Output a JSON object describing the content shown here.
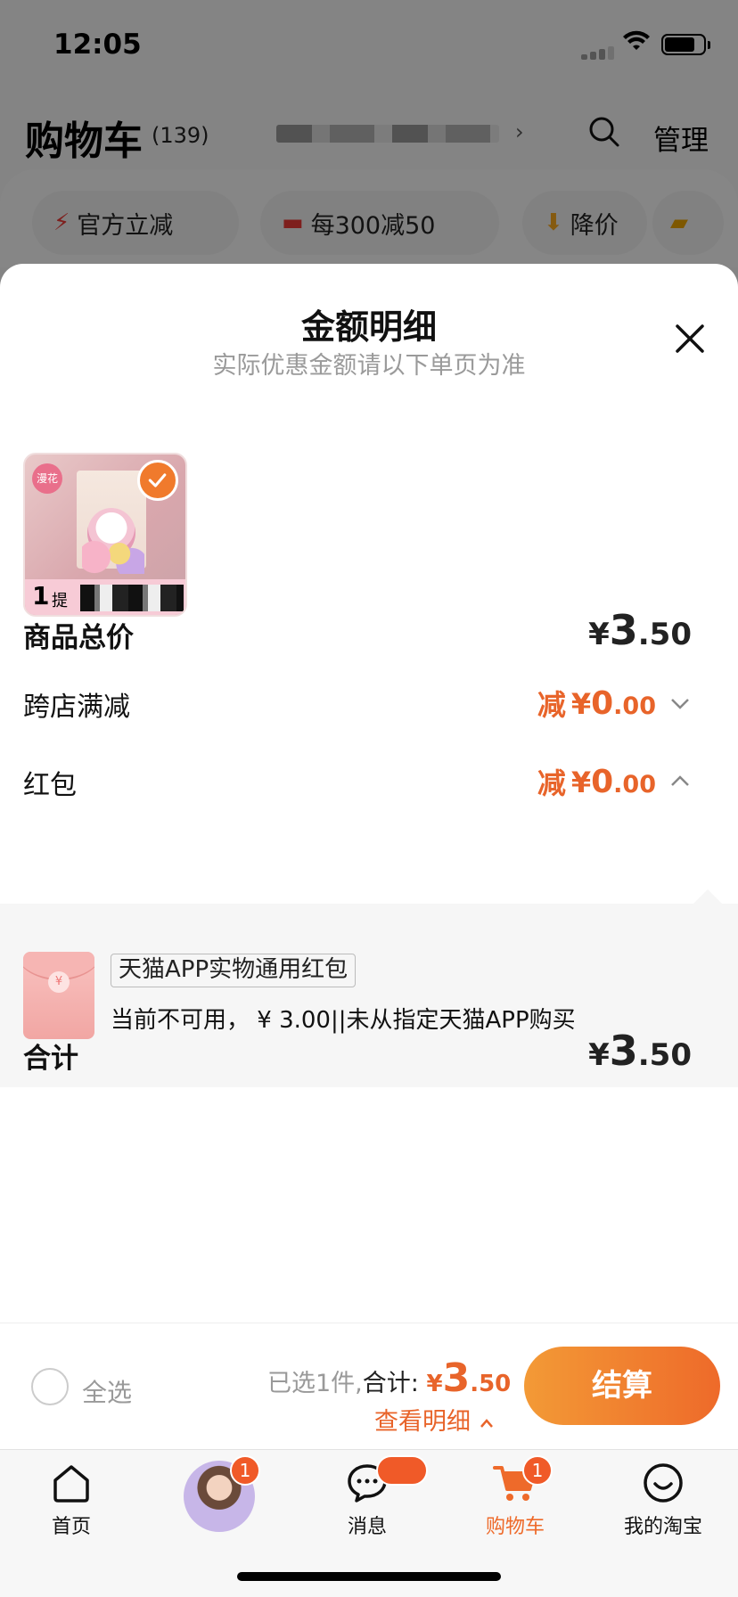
{
  "status_bar": {
    "time": "12:05"
  },
  "cart_header": {
    "title": "购物车",
    "count": "(139)",
    "manage_label": "管理",
    "address_chevron": "›"
  },
  "promo_chips": [
    {
      "icon": "lightning-icon",
      "label": "官方立减"
    },
    {
      "icon": "store-icon",
      "label": "每300减50"
    },
    {
      "icon": "price-drop-icon",
      "label": "降价"
    },
    {
      "icon": "folder-icon",
      "label": ""
    }
  ],
  "sheet": {
    "title": "金额明细",
    "subtitle": "实际优惠金额请以下单页为准",
    "product": {
      "tag": "漫花",
      "count_number": "1",
      "count_unit": "提"
    },
    "rows": {
      "goods_total": {
        "label": "商品总价",
        "currency": "¥",
        "integer": "3",
        "decimal": ".50"
      },
      "cross_store": {
        "label": "跨店满减",
        "prefix": "减",
        "currency": "¥",
        "integer": "0",
        "decimal": ".00"
      },
      "red_packet": {
        "label": "红包",
        "prefix": "减",
        "currency": "¥",
        "integer": "0",
        "decimal": ".00"
      }
    },
    "red_packet_detail": {
      "coin_symbol": "¥",
      "name": "天猫APP实物通用红包",
      "note": "当前不可用， ¥ 3.00||未从指定天猫APP购买"
    },
    "total": {
      "label": "合计",
      "currency": "¥",
      "integer": "3",
      "decimal": ".50"
    }
  },
  "checkout": {
    "select_all": "全选",
    "selected_prefix": "已选1件,",
    "total_label": "合计:",
    "currency": "¥",
    "integer": "3",
    "decimal": ".50",
    "view_detail": "查看明细",
    "view_detail_icon": "chevron-up-icon",
    "pay_button": "结算"
  },
  "tabbar": {
    "items": [
      {
        "label": "首页",
        "icon": "home-icon"
      },
      {
        "label": "",
        "icon": "avatar",
        "badge": "1"
      },
      {
        "label": "消息",
        "icon": "message-icon"
      },
      {
        "label": "购物车",
        "icon": "cart-icon",
        "badge": "1",
        "active": true
      },
      {
        "label": "我的淘宝",
        "icon": "smile-icon"
      }
    ]
  },
  "colors": {
    "accent": "#EE6A2A",
    "discount": "#E8642A",
    "muted": "#9A9A9A"
  }
}
